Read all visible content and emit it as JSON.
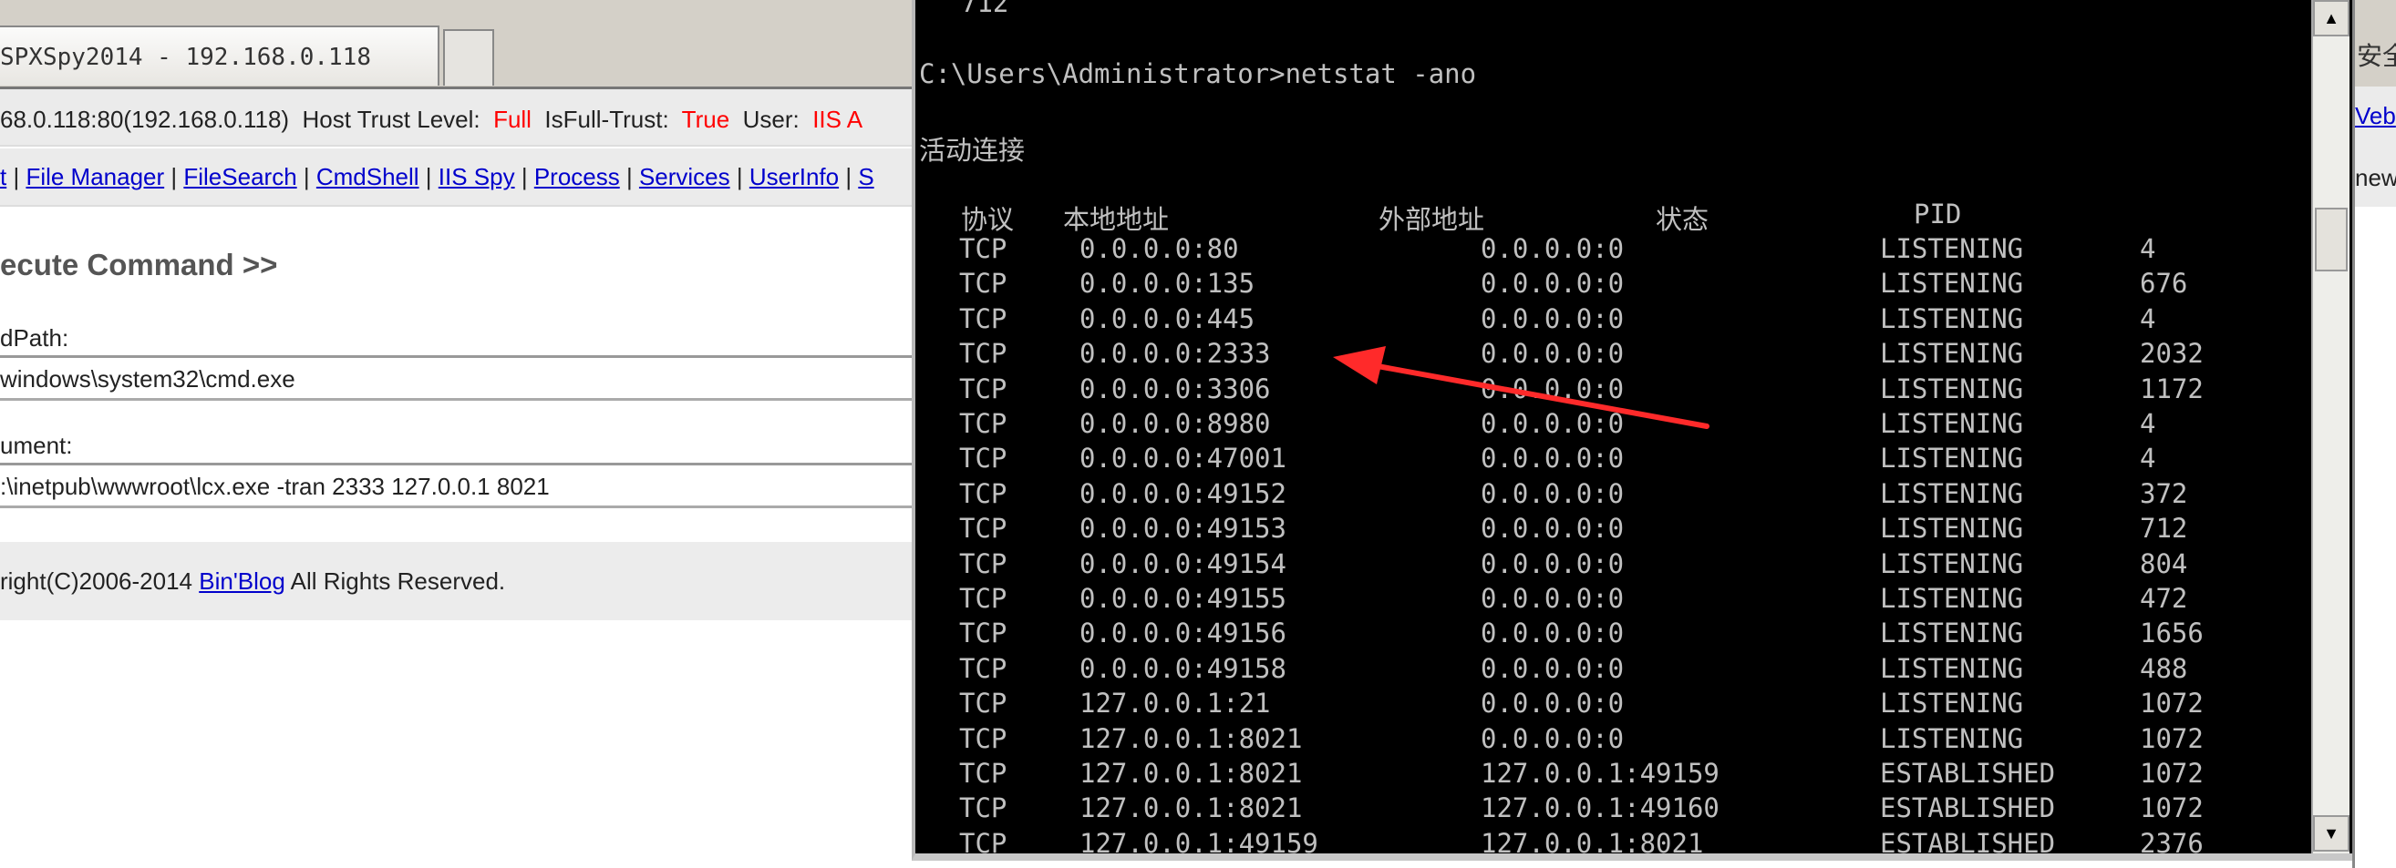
{
  "browser": {
    "tab_title": "SPXSpy2014 - 192.168.0.118",
    "right_cut": "安全"
  },
  "info": {
    "host": "68.0.118:80(192.168.0.118)",
    "trust_label": "Host Trust Level:",
    "trust_value": "Full",
    "fulltrust_label": "IsFull-Trust:",
    "fulltrust_value": "True",
    "user_label": "User:",
    "user_value": "IIS A",
    "right_cut": "Veb"
  },
  "nav": {
    "items": [
      "t",
      "File Manager",
      "FileSearch",
      "CmdShell",
      "IIS Spy",
      "Process",
      "Services",
      "UserInfo",
      "S"
    ],
    "right_cut": "new"
  },
  "main": {
    "heading": "ecute Command >>",
    "path_label": "dPath:",
    "path_value": "windows\\system32\\cmd.exe",
    "arg_label": "ument:",
    "arg_value": ":\\inetpub\\wwwroot\\lcx.exe -tran 2333 127.0.0.1 8021"
  },
  "footer": {
    "prefix": "right(C)2006-2014 ",
    "link": "Bin'Blog",
    "suffix": " All Rights Reserved."
  },
  "console": {
    "prev_line": "712",
    "prompt": "C:\\Users\\Administrator>netstat -ano",
    "section": "活动连接",
    "headers": [
      "协议",
      "本地地址",
      "外部地址",
      "状态",
      "PID"
    ],
    "rows": [
      [
        "TCP",
        "0.0.0.0:80",
        "0.0.0.0:0",
        "LISTENING",
        "4"
      ],
      [
        "TCP",
        "0.0.0.0:135",
        "0.0.0.0:0",
        "LISTENING",
        "676"
      ],
      [
        "TCP",
        "0.0.0.0:445",
        "0.0.0.0:0",
        "LISTENING",
        "4"
      ],
      [
        "TCP",
        "0.0.0.0:2333",
        "0.0.0.0:0",
        "LISTENING",
        "2032"
      ],
      [
        "TCP",
        "0.0.0.0:3306",
        "0.0.0.0:0",
        "LISTENING",
        "1172"
      ],
      [
        "TCP",
        "0.0.0.0:8980",
        "0.0.0.0:0",
        "LISTENING",
        "4"
      ],
      [
        "TCP",
        "0.0.0.0:47001",
        "0.0.0.0:0",
        "LISTENING",
        "4"
      ],
      [
        "TCP",
        "0.0.0.0:49152",
        "0.0.0.0:0",
        "LISTENING",
        "372"
      ],
      [
        "TCP",
        "0.0.0.0:49153",
        "0.0.0.0:0",
        "LISTENING",
        "712"
      ],
      [
        "TCP",
        "0.0.0.0:49154",
        "0.0.0.0:0",
        "LISTENING",
        "804"
      ],
      [
        "TCP",
        "0.0.0.0:49155",
        "0.0.0.0:0",
        "LISTENING",
        "472"
      ],
      [
        "TCP",
        "0.0.0.0:49156",
        "0.0.0.0:0",
        "LISTENING",
        "1656"
      ],
      [
        "TCP",
        "0.0.0.0:49158",
        "0.0.0.0:0",
        "LISTENING",
        "488"
      ],
      [
        "TCP",
        "127.0.0.1:21",
        "0.0.0.0:0",
        "LISTENING",
        "1072"
      ],
      [
        "TCP",
        "127.0.0.1:8021",
        "0.0.0.0:0",
        "LISTENING",
        "1072"
      ],
      [
        "TCP",
        "127.0.0.1:8021",
        "127.0.0.1:49159",
        "ESTABLISHED",
        "1072"
      ],
      [
        "TCP",
        "127.0.0.1:8021",
        "127.0.0.1:49160",
        "ESTABLISHED",
        "1072"
      ],
      [
        "TCP",
        "127.0.0.1:49159",
        "127.0.0.1:8021",
        "ESTABLISHED",
        "2376"
      ]
    ],
    "scroll_up": "▲",
    "scroll_down": "▼"
  },
  "annotation": {
    "arrow_color": "#ff2a2a"
  }
}
